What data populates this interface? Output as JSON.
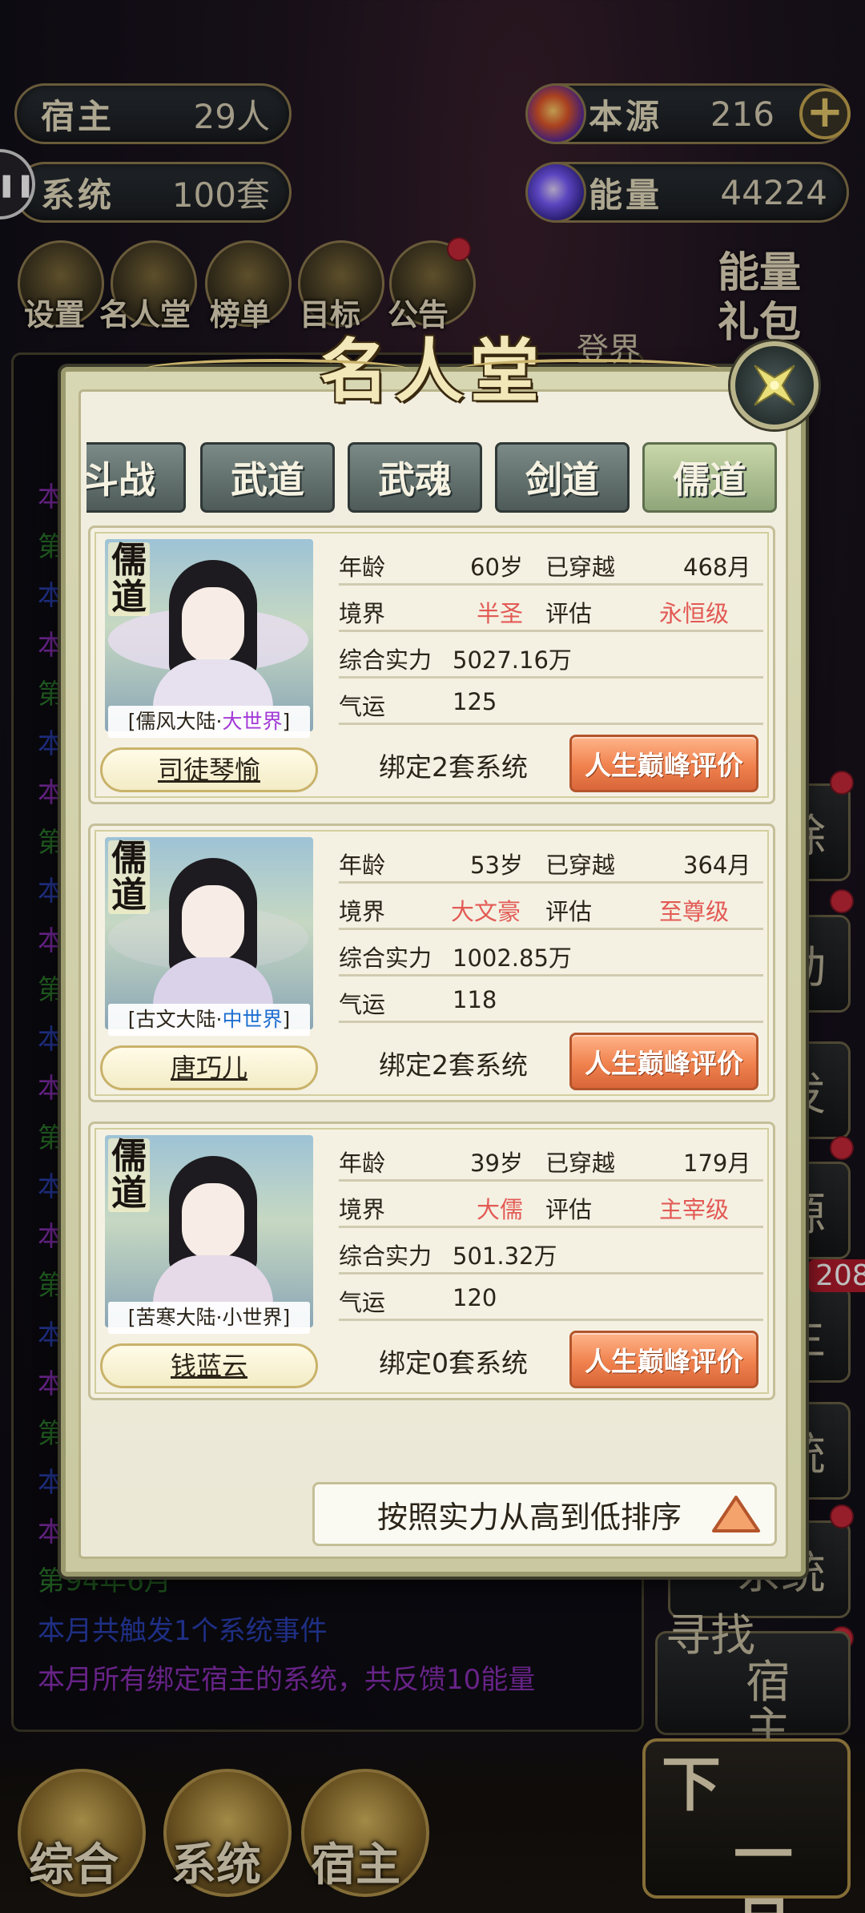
{
  "hud": {
    "hosts_label": "宿主",
    "hosts_value": "29人",
    "systems_label": "系统",
    "systems_value": "100套",
    "source_label": "本源",
    "source_value": "216",
    "energy_label": "能量",
    "energy_value": "44224",
    "side_tab_glyph": "❚❚",
    "icons": [
      {
        "label": "设置",
        "icon": "gear-icon"
      },
      {
        "label": "名人堂",
        "icon": "hall-icon"
      },
      {
        "label": "榜单",
        "icon": "ranking-icon"
      },
      {
        "label": "目标",
        "icon": "target-icon"
      },
      {
        "label": "公告",
        "icon": "notice-icon"
      }
    ],
    "gift_line1": "能量",
    "gift_line2": "礼包"
  },
  "log": {
    "partial_line": "登界",
    "lines": [
      {
        "text": "本",
        "color": "#8a2fb5"
      },
      {
        "text": "第",
        "color": "#2b7a2b"
      },
      {
        "text": "本",
        "color": "#2a3fb0"
      },
      {
        "text": "本",
        "color": "#8a2fb5"
      },
      {
        "text": "第",
        "color": "#2b7a2b"
      },
      {
        "text": "本",
        "color": "#2a3fb0"
      },
      {
        "text": "本",
        "color": "#8a2fb5"
      },
      {
        "text": "第",
        "color": "#2b7a2b"
      },
      {
        "text": "本",
        "color": "#2a3fb0"
      },
      {
        "text": "本",
        "color": "#8a2fb5"
      },
      {
        "text": "第",
        "color": "#2b7a2b"
      },
      {
        "text": "本",
        "color": "#2a3fb0"
      },
      {
        "text": "本",
        "color": "#8a2fb5"
      },
      {
        "text": "第",
        "color": "#2b7a2b"
      },
      {
        "text": "本",
        "color": "#2a3fb0"
      },
      {
        "text": "本",
        "color": "#8a2fb5"
      },
      {
        "text": "第",
        "color": "#2b7a2b"
      },
      {
        "text": "本",
        "color": "#2a3fb0"
      },
      {
        "text": "本",
        "color": "#8a2fb5"
      },
      {
        "text": "第",
        "color": "#2b7a2b"
      },
      {
        "text": "本",
        "color": "#2a3fb0"
      },
      {
        "text": "本",
        "color": "#8a2fb5"
      }
    ],
    "footer": [
      {
        "text": "第94年6月",
        "color": "#2b7a2b"
      },
      {
        "text": "本月共触发1个系统事件",
        "color": "#2a3fb0"
      },
      {
        "text": "本月所有绑定宿主的系统，共反馈10能量",
        "color": "#8a2fb5"
      }
    ]
  },
  "right_buttons": [
    "除",
    "动",
    "发",
    "源",
    "主",
    "统",
    "系统"
  ],
  "right_badge": "208",
  "find_host": {
    "line1": "寻找",
    "line2": "宿主"
  },
  "bottom_nav": {
    "overview": "综合",
    "system": "系统",
    "host": "宿主",
    "next_line1": "下",
    "next_line2": "一月"
  },
  "modal": {
    "title": "名人堂",
    "tabs": [
      "斗战",
      "武道",
      "武魂",
      "剑道",
      "儒道"
    ],
    "active_tab": "儒道",
    "labels": {
      "age": "年龄",
      "traveled": "已穿越",
      "realm": "境界",
      "assess": "评估",
      "power": "综合实力",
      "luck": "气运"
    },
    "eval_button": "人生巅峰评价",
    "sort_label": "按照实力从高到低排序",
    "cards": [
      {
        "tag": "儒道",
        "world_name": "[儒风大陆·",
        "world_tier": "大世界",
        "world_close": "]",
        "tier_color": "purple",
        "name": "司徒琴愉",
        "age": "60岁",
        "traveled": "468月",
        "realm": "半圣",
        "assess": "永恒级",
        "power": "5027.16万",
        "luck": "125",
        "bind": "绑定2套系统"
      },
      {
        "tag": "儒道",
        "world_name": "[古文大陆·",
        "world_tier": "中世界",
        "world_close": "]",
        "tier_color": "blue",
        "name": "唐巧儿",
        "age": "53岁",
        "traveled": "364月",
        "realm": "大文豪",
        "assess": "至尊级",
        "power": "1002.85万",
        "luck": "118",
        "bind": "绑定2套系统"
      },
      {
        "tag": "儒道",
        "world_name": "[苦寒大陆·",
        "world_tier": "小世界",
        "world_close": "]",
        "tier_color": "dark",
        "name": "钱蓝云",
        "age": "39岁",
        "traveled": "179月",
        "realm": "大儒",
        "assess": "主宰级",
        "power": "501.32万",
        "luck": "120",
        "bind": "绑定0套系统"
      }
    ]
  }
}
